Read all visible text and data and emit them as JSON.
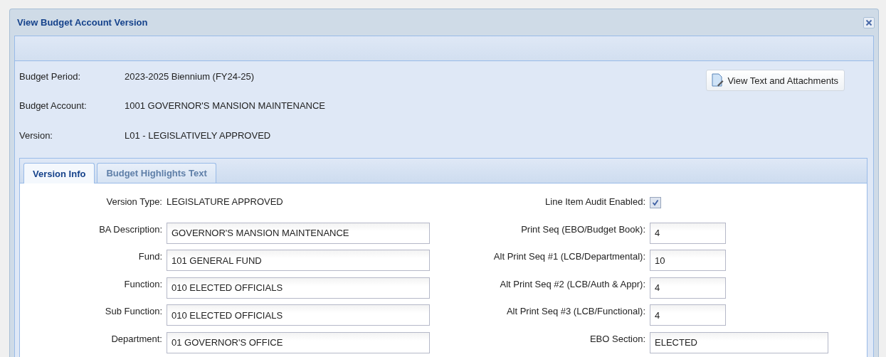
{
  "window": {
    "title": "View Budget Account Version"
  },
  "header": [
    {
      "label": "Budget Period:",
      "value": "2023-2025 Biennium (FY24-25)"
    },
    {
      "label": "Budget Account:",
      "value": "1001 GOVERNOR'S MANSION MAINTENANCE"
    },
    {
      "label": "Version:",
      "value": "L01 - LEGISLATIVELY APPROVED"
    }
  ],
  "attachments_button": {
    "label": "View Text and Attachments"
  },
  "tabs": [
    {
      "label": "Version Info",
      "selected": true
    },
    {
      "label": "Budget Highlights Text",
      "selected": false
    }
  ],
  "left_fields": [
    {
      "kind": "text",
      "label": "Version Type:",
      "value": "LEGISLATURE APPROVED"
    },
    {
      "kind": "input",
      "label": "BA Description:",
      "value": "GOVERNOR'S MANSION MAINTENANCE"
    },
    {
      "kind": "input",
      "label": "Fund:",
      "value": "101 GENERAL FUND"
    },
    {
      "kind": "input",
      "label": "Function:",
      "value": "010 ELECTED OFFICIALS"
    },
    {
      "kind": "input",
      "label": "Sub Function:",
      "value": "010 ELECTED OFFICIALS"
    },
    {
      "kind": "input",
      "label": "Department:",
      "value": "01 GOVERNOR'S OFFICE"
    }
  ],
  "right_fields": [
    {
      "kind": "checkbox",
      "label": "Line Item Audit Enabled:",
      "checked": true
    },
    {
      "kind": "short",
      "label": "Print Seq (EBO/Budget Book):",
      "value": "4"
    },
    {
      "kind": "short",
      "label": "Alt Print Seq #1 (LCB/Departmental):",
      "value": "10"
    },
    {
      "kind": "short",
      "label": "Alt Print Seq #2 (LCB/Auth & Appr):",
      "value": "4"
    },
    {
      "kind": "short",
      "label": "Alt Print Seq #3 (LCB/Functional):",
      "value": "4"
    },
    {
      "kind": "input",
      "label": "EBO Section:",
      "value": "ELECTED"
    }
  ]
}
